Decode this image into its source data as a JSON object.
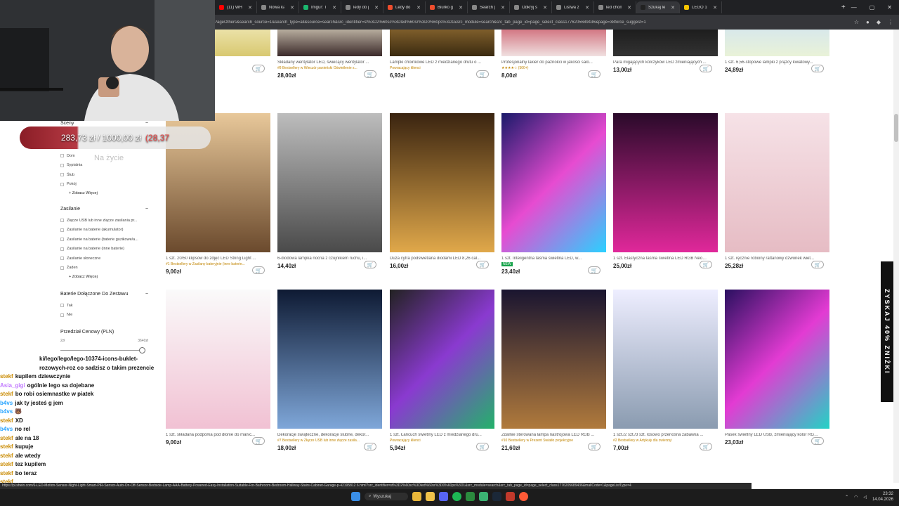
{
  "browser": {
    "tabs": [
      {
        "label": "(11) WHITE W",
        "color": "#ff0000"
      },
      {
        "label": "Nowa karta",
        "color": "#888888"
      },
      {
        "label": "Imgur: The m",
        "color": "#1bb76e"
      },
      {
        "label": "ledy do pokoj",
        "color": "#888888"
      },
      {
        "label": "Ledy do Poko",
        "color": "#ee4d2d"
      },
      {
        "label": "Biurko gamin",
        "color": "#ee4d2d"
      },
      {
        "label": "Search | Activ",
        "color": "#888888"
      },
      {
        "label": "Odkryj świat",
        "color": "#888888"
      },
      {
        "label": "Listwa z diod",
        "color": "#888888"
      },
      {
        "label": "led chomik",
        "color": "#888888"
      },
      {
        "label": "Szukaj led | S",
        "color": "#222222",
        "active": true
      },
      {
        "label": "LEGO 10328",
        "color": "#f5c400"
      }
    ],
    "new_tab": "+",
    "window_controls": [
      "—",
      "▢",
      "✕"
    ],
    "url": "PageOthers&search_source=1&search_type=all&source=search&src_identifier=st%3D2%60sc%3Dled%60sr%3D0%60ps%3D1&src_module=search&src_tab_page_id=page_select_class1776205689436&page=38force_suggest=1"
  },
  "overlay": {
    "goal_current": "283,73 zł",
    "goal_sep": "/",
    "goal_target": "1000,00 zł",
    "goal_pct": "(28,37",
    "goal_sub": "Na życie"
  },
  "filters": {
    "scenes_title": "Sceny",
    "scenes": [
      "Dom",
      "Sypialnia",
      "Ślub",
      "Pokój"
    ],
    "more": "+ Zobacz Więcej",
    "power_title": "Zasilanie",
    "power": [
      "Złącze USB lub inne złącze zasilania pr...",
      "Zasilanie na baterie (akumulator)",
      "Zasilanie na baterie (baterie guzikowe/a...",
      "Zasilanie na baterie (inne baterie)",
      "Zasilanie słoneczne",
      "Żaden"
    ],
    "battery_title": "Baterie Dołączone Do Zestawu",
    "battery": [
      "Tak",
      "Nie"
    ],
    "price_title": "Przedział Cenowy (PLN)",
    "price_min": "2zł",
    "price_max": "3640zł",
    "collapse": "−"
  },
  "products_row0": [
    {
      "title": "LED z motywem liści, s...",
      "price": "",
      "badge": ""
    },
    {
      "title": "Składany wentylator LED, świecący wentylator ...",
      "price": "28,00zł",
      "badge": "#8 Bestsellery w Wieczór panieński Oświetlenie s..."
    },
    {
      "title": "Lampki choinkowe LED z miedzianego drutu o ...",
      "price": "6,93zł",
      "badge": "Powracający klienci"
    },
    {
      "title": "Profesjonalny lakier do paznokci w jakości salo...",
      "price": "8,00zł",
      "badge": "★★★★☆ (500+)"
    },
    {
      "title": "Para migających kolczyków LED zmieniających ...",
      "price": "13,00zł",
      "badge": ""
    },
    {
      "title": "1 szt. 6,56-stopowe lampki z prążcy kwiatowy...",
      "price": "24,89zł",
      "badge": ""
    }
  ],
  "products_row1": [
    {
      "title": "1 szt. 20/50 klipsów do zdjęć LED String Light ...",
      "price": "9,00zł",
      "badge": "#1 Bestsellery w Zasilany bateryjnie (inne baterie..."
    },
    {
      "title": "6-diodowa lampka nocna z czujnikiem ruchu, i...",
      "price": "14,40zł",
      "badge": ""
    },
    {
      "title": "Duża cyfra podświetlana diodami LED 8,26 cal...",
      "price": "16,00zł",
      "badge": ""
    },
    {
      "title": "1 szt. Inteligentna taśma świetlna LED, w...",
      "price": "23,40zł",
      "badge": "NEW"
    },
    {
      "title": "1 szt. Elastyczna taśma świetlna LED RGB Neon...",
      "price": "25,00zł",
      "badge": ""
    },
    {
      "title": "1 szt. ręcznie robiony rattanowy dzwonek wiet...",
      "price": "25,28zł",
      "badge": ""
    }
  ],
  "products_row2": [
    {
      "title": "1 szt. składana podpórka pod dłonie do manic...",
      "price": "9,00zł",
      "badge": ""
    },
    {
      "title": "Dekoracje świąteczne, dekoracje ślubne, dekor...",
      "price": "18,00zł",
      "badge": "#7 Bestsellery w Złącze USB lub inne złącze zasila..."
    },
    {
      "title": "1 szt. Łańcuch świetlny LED z miedzianego dru...",
      "price": "5,94zł",
      "badge": "Powracający klienci"
    },
    {
      "title": "Zdalnie sterowana lampa nastrojowa LED RGB ...",
      "price": "21,60zł",
      "badge": "#10 Bestsellery w Prezent Światło projekcyjne"
    },
    {
      "title": "1 szt./2 szt./3 szt. losowo przenośna zabawka ...",
      "price": "7,00zł",
      "badge": "#2 Bestsellery w Artykuły dla zwierząt"
    },
    {
      "title": "Pasek świetlny LED USB, zmieniający kolor RGB...",
      "price": "23,03zł",
      "badge": ""
    }
  ],
  "chat": [
    {
      "user": "",
      "text": "ki/lego/lego/lego-10374-icons-buklet-rozowych-roz co sadzisz o takim prezencie",
      "color": "#111111"
    },
    {
      "user": "stekf",
      "text": "kupilem dziewczynie",
      "color": "#c98a00"
    },
    {
      "user": "Asia_gigi",
      "text": "ogólnie lego sa dojebane",
      "color": "#c078ff"
    },
    {
      "user": "stekf",
      "text": "bo robi osiemnastke w piatek",
      "color": "#c98a00"
    },
    {
      "user": "b4vs",
      "text": "jak ty jesteś g jem",
      "color": "#2aa5ff"
    },
    {
      "user": "b4vs",
      "text": "🐻",
      "color": "#2aa5ff"
    },
    {
      "user": "stekf",
      "text": "XD",
      "color": "#c98a00"
    },
    {
      "user": "b4vs",
      "text": "no rel",
      "color": "#2aa5ff"
    },
    {
      "user": "stekf",
      "text": "ale na 18",
      "color": "#c98a00"
    },
    {
      "user": "stekf",
      "text": "kupuje",
      "color": "#c98a00"
    },
    {
      "user": "stekf",
      "text": "ale wtedy",
      "color": "#c98a00"
    },
    {
      "user": "stekf",
      "text": "tez kupilem",
      "color": "#c98a00"
    },
    {
      "user": "stekf",
      "text": "bo teraz",
      "color": "#c98a00"
    },
    {
      "user": "stekf",
      "text": "",
      "color": "#c98a00"
    }
  ],
  "promo": "ZYSKAJ 40% ZNIŻKI",
  "status_url": "https://pl.shein.com/6-LED-Motion-Sensor-Night-Light-Smart-PIR-Sensor-Auto-On-Off-Sensor-Bedside-Lamp-AAA-Battery-Powered-Easy-Installation-Suitable-For-Bathroom-Bedroom-Hallway-Stairs-Cabinet-Garage-p-42195812 6.html?src_identifier=st%3D2%60sc%3Dled%60sr%3D0%60ps%3D1&src_module=search&src_tab_page_id=page_select_class1776205689436&mallCode=1&pageListType=4",
  "taskbar": {
    "search": "Wyszukaj",
    "time": "23:32",
    "date": "14.04.2026"
  }
}
